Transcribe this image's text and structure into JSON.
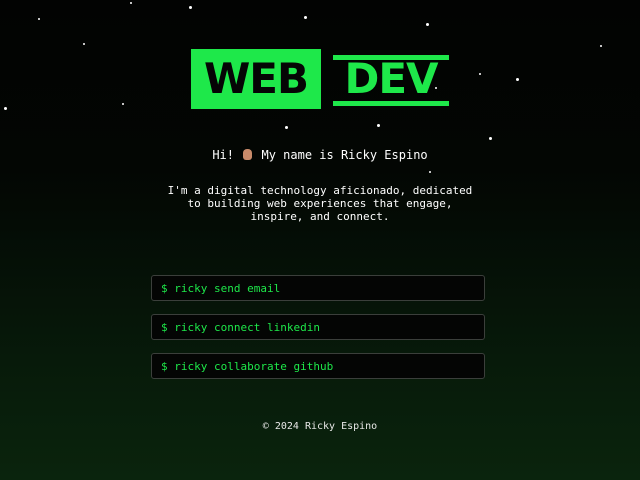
{
  "logo": {
    "left_word": "WEB",
    "right_word": "DEV",
    "accent_color": "#1ee84a"
  },
  "greeting": {
    "before": "Hi!",
    "emoji_icon": "waving-hand-icon",
    "after": "My name is Ricky Espino"
  },
  "intro": "I'm a digital technology aficionado, dedicated\nto building web experiences that engage,\ninspire, and connect.",
  "commands": [
    {
      "label": "$ ricky send email"
    },
    {
      "label": "$ ricky connect linkedin"
    },
    {
      "label": "$ ricky collaborate github"
    }
  ],
  "footer": "© 2024 Ricky Espino"
}
